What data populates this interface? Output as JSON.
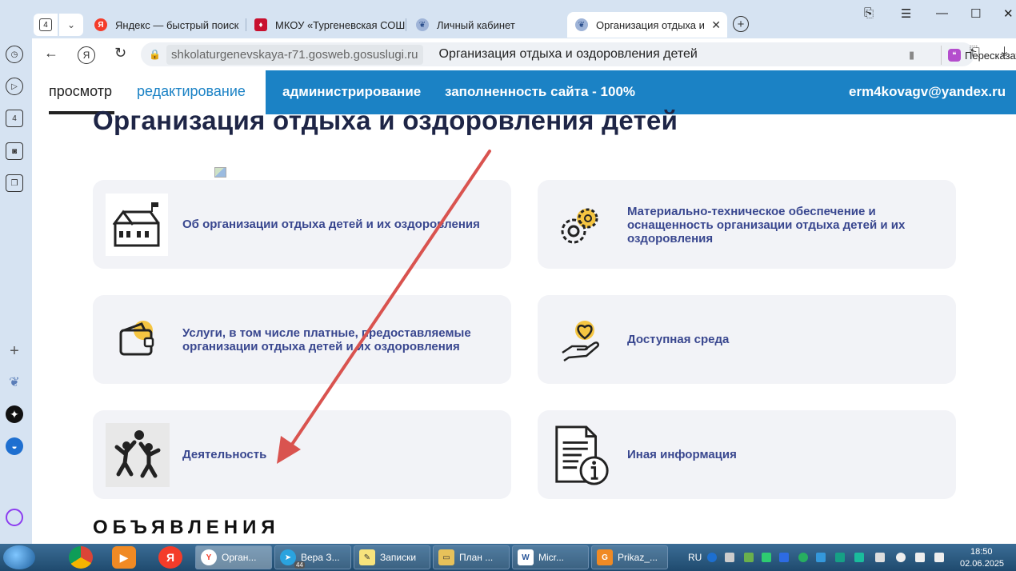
{
  "browser": {
    "tab_count": "4",
    "tabs": [
      {
        "title": "Яндекс — быстрый поиск",
        "icon": "yandex-icon"
      },
      {
        "title": "МКОУ «Тургеневская СОШ»",
        "icon": "emblem-icon"
      },
      {
        "title": "Личный кабинет",
        "icon": "gosuslugi-icon"
      },
      {
        "title": "Организация отдыха и",
        "icon": "gosuslugi-icon"
      }
    ],
    "url": "shkolaturgenevskaya-r71.gosweb.gosuslugi.ru",
    "page_title": "Организация отдыха и оздоровления детей",
    "retell_label": "Пересказать",
    "sidebar_tab_count": "4"
  },
  "adminbar": {
    "view_label": "просмотр",
    "edit_label": "редактирование",
    "admin_label": "администрирование",
    "fill_label": "заполненность сайта - 100%",
    "user_email": "erm4kovagv@yandex.ru"
  },
  "page": {
    "heading": "Организация отдыха и оздоровления детей",
    "cards": [
      {
        "label": "Об организации отдыха детей и их оздоровления",
        "icon": "school-building-icon"
      },
      {
        "label": "Материально-техническое обеспечение и оснащенность организации отдыха детей и их оздоровления",
        "icon": "gears-icon"
      },
      {
        "label": "Услуги, в том числе платные, предоставляемые организации отдыха детей и их оздоровления",
        "icon": "wallet-icon"
      },
      {
        "label": "Доступная среда",
        "icon": "heart-hand-icon"
      },
      {
        "label": "Деятельность",
        "icon": "children-playing-icon"
      },
      {
        "label": "Иная информация",
        "icon": "document-info-icon"
      }
    ],
    "announcements_heading": "ОБЪЯВЛЕНИЯ"
  },
  "taskbar": {
    "items": [
      {
        "label": "Орган...",
        "icon": "yandex-browser-icon"
      },
      {
        "label": "Вера З...",
        "icon": "telegram-icon",
        "badge": "44"
      },
      {
        "label": "Записки",
        "icon": "notes-icon"
      },
      {
        "label": "План ...",
        "icon": "folder-icon"
      },
      {
        "label": "Micr...",
        "icon": "word-icon"
      },
      {
        "label": "Prikaz_...",
        "icon": "pdf-icon"
      }
    ],
    "language": "RU",
    "time": "18:50",
    "date": "02.06.2025"
  },
  "colors": {
    "admin_bar": "#1b82c5",
    "card_bg": "#f2f3f7",
    "card_text": "#39478f",
    "heading": "#1e2546",
    "annotation_arrow": "#d9534f"
  }
}
